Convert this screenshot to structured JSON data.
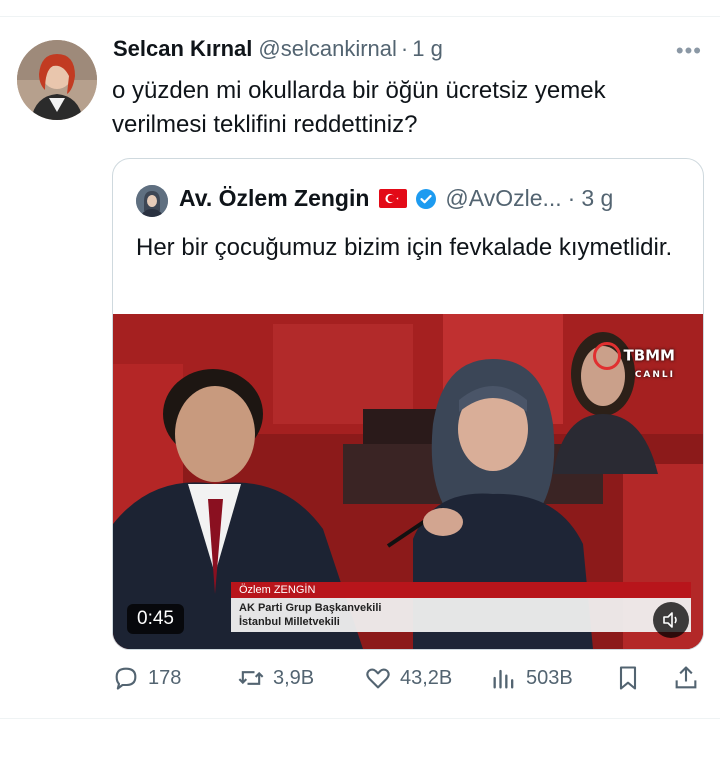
{
  "tweet": {
    "author_name": "Selcan Kırnal",
    "author_handle": "@selcankirnal",
    "separator": "·",
    "time": "1 g",
    "more": "•••",
    "text": "o yüzden mi  okullarda bir öğün ücretsiz yemek verilmesi teklifini reddettiniz?"
  },
  "quote": {
    "author_name": "Av. Özlem Zengin",
    "author_handle": "@AvOzle...",
    "separator": "·",
    "time": "3 g",
    "text": "Her bir çocuğumuz bizim için fevkalade kıymetlidir.",
    "video": {
      "channel_logo": "TBMM",
      "channel_sub": "CANLI",
      "speaker_name": "Özlem ZENGİN",
      "speaker_role_1": "AK Parti Grup Başkanvekili",
      "speaker_role_2": "İstanbul Milletvekili",
      "duration": "0:45"
    }
  },
  "actions": {
    "reply_count": "178",
    "retweet_count": "3,9B",
    "like_count": "43,2B",
    "view_count": "503B"
  },
  "icons": {
    "reply": "reply-icon",
    "retweet": "retweet-icon",
    "like": "heart-icon",
    "views": "views-icon",
    "bookmark": "bookmark-icon",
    "share": "share-icon",
    "verified": "verified-badge-icon",
    "flag": "turkey-flag-icon",
    "volume": "volume-icon"
  },
  "colors": {
    "muted": "#536471",
    "verified_blue": "#1d9bf0",
    "flag_red": "#e30a17"
  }
}
